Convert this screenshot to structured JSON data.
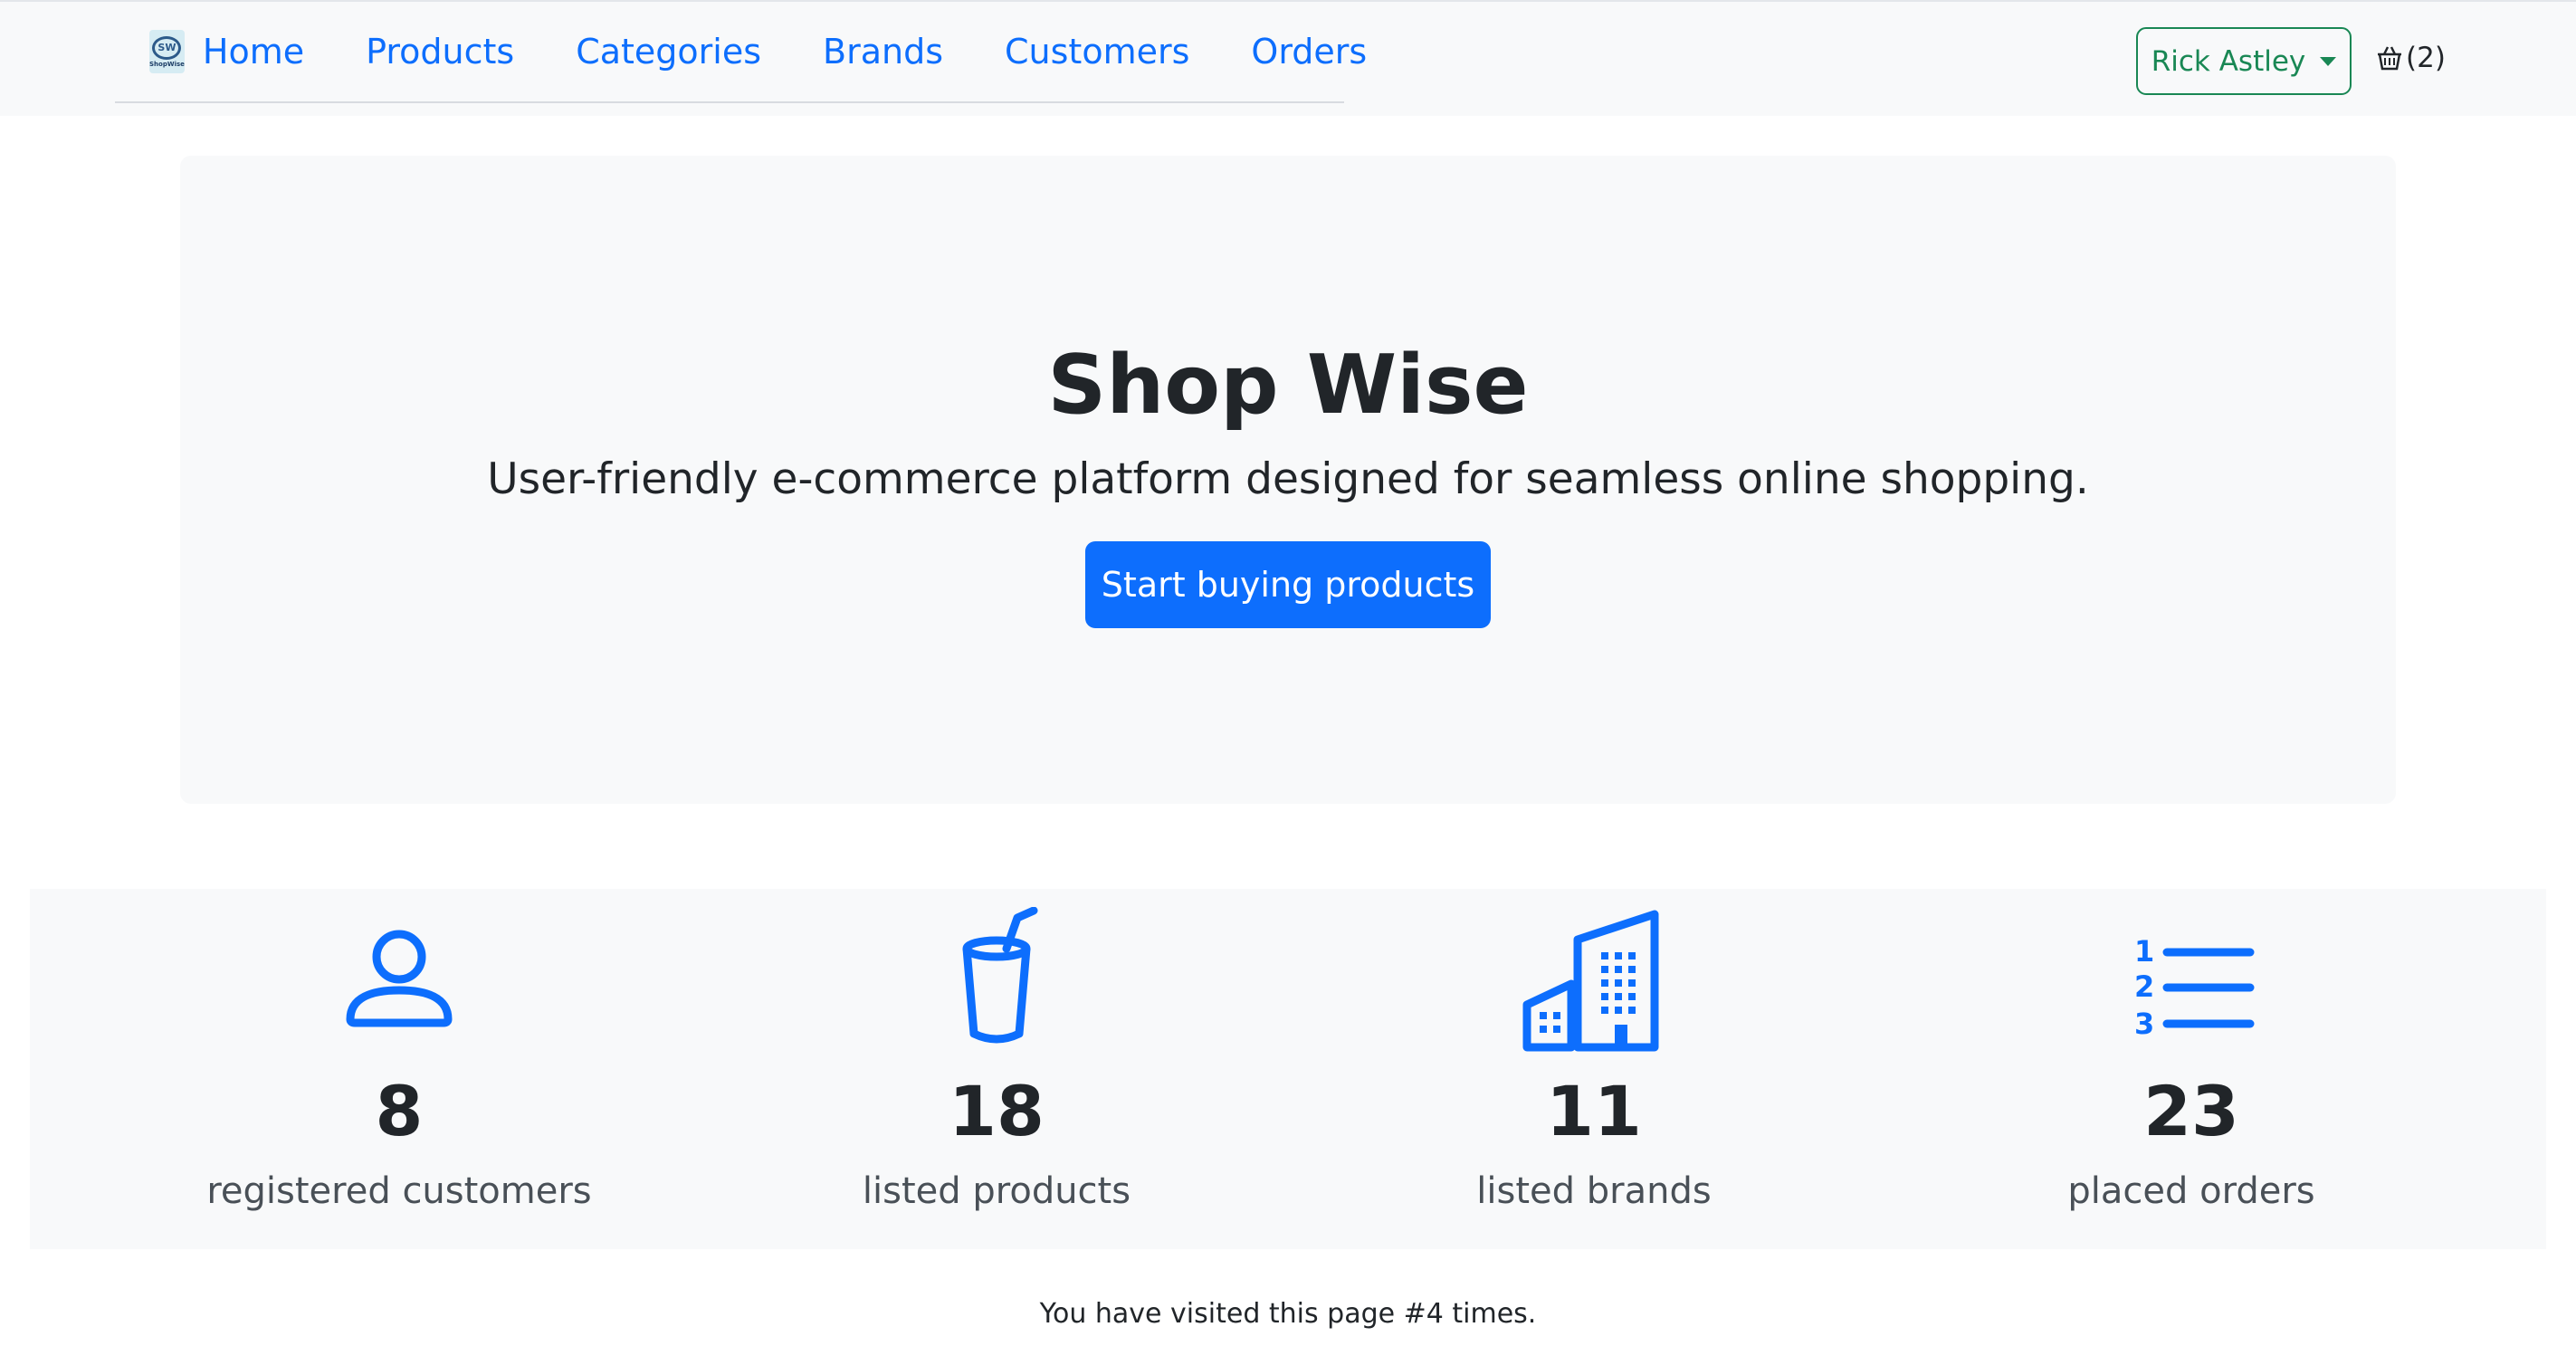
{
  "brand": {
    "logo_text": "SW",
    "logo_caption": "ShopWise"
  },
  "nav": {
    "home": "Home",
    "products": "Products",
    "categories": "Categories",
    "brands": "Brands",
    "customers": "Customers",
    "orders": "Orders"
  },
  "user": {
    "name": "Rick Astley"
  },
  "cart": {
    "count_label": "(2)"
  },
  "hero": {
    "title": "Shop Wise",
    "subtitle": "User-friendly e-commerce platform designed for seamless online shopping.",
    "cta_label": "Start buying products"
  },
  "stats": [
    {
      "icon": "person-icon",
      "value": "8",
      "label": "registered customers"
    },
    {
      "icon": "cup-straw-icon",
      "value": "18",
      "label": "listed products"
    },
    {
      "icon": "buildings-icon",
      "value": "11",
      "label": "listed brands"
    },
    {
      "icon": "list-ol-icon",
      "value": "23",
      "label": "placed orders"
    }
  ],
  "footer": {
    "visits": "You have visited this page #4 times."
  },
  "colors": {
    "primary": "#0d6efd",
    "success": "#198754",
    "light": "#f8f9fa"
  }
}
